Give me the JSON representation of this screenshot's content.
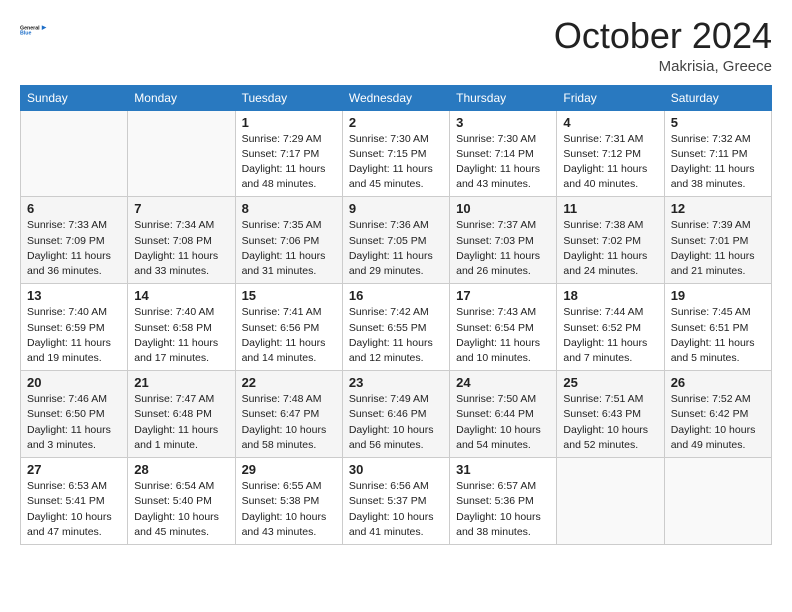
{
  "header": {
    "logo_line1": "General",
    "logo_line2": "Blue",
    "month": "October 2024",
    "location": "Makrisia, Greece"
  },
  "days_of_week": [
    "Sunday",
    "Monday",
    "Tuesday",
    "Wednesday",
    "Thursday",
    "Friday",
    "Saturday"
  ],
  "weeks": [
    [
      {
        "day": "",
        "info": ""
      },
      {
        "day": "",
        "info": ""
      },
      {
        "day": "1",
        "info": "Sunrise: 7:29 AM\nSunset: 7:17 PM\nDaylight: 11 hours and 48 minutes."
      },
      {
        "day": "2",
        "info": "Sunrise: 7:30 AM\nSunset: 7:15 PM\nDaylight: 11 hours and 45 minutes."
      },
      {
        "day": "3",
        "info": "Sunrise: 7:30 AM\nSunset: 7:14 PM\nDaylight: 11 hours and 43 minutes."
      },
      {
        "day": "4",
        "info": "Sunrise: 7:31 AM\nSunset: 7:12 PM\nDaylight: 11 hours and 40 minutes."
      },
      {
        "day": "5",
        "info": "Sunrise: 7:32 AM\nSunset: 7:11 PM\nDaylight: 11 hours and 38 minutes."
      }
    ],
    [
      {
        "day": "6",
        "info": "Sunrise: 7:33 AM\nSunset: 7:09 PM\nDaylight: 11 hours and 36 minutes."
      },
      {
        "day": "7",
        "info": "Sunrise: 7:34 AM\nSunset: 7:08 PM\nDaylight: 11 hours and 33 minutes."
      },
      {
        "day": "8",
        "info": "Sunrise: 7:35 AM\nSunset: 7:06 PM\nDaylight: 11 hours and 31 minutes."
      },
      {
        "day": "9",
        "info": "Sunrise: 7:36 AM\nSunset: 7:05 PM\nDaylight: 11 hours and 29 minutes."
      },
      {
        "day": "10",
        "info": "Sunrise: 7:37 AM\nSunset: 7:03 PM\nDaylight: 11 hours and 26 minutes."
      },
      {
        "day": "11",
        "info": "Sunrise: 7:38 AM\nSunset: 7:02 PM\nDaylight: 11 hours and 24 minutes."
      },
      {
        "day": "12",
        "info": "Sunrise: 7:39 AM\nSunset: 7:01 PM\nDaylight: 11 hours and 21 minutes."
      }
    ],
    [
      {
        "day": "13",
        "info": "Sunrise: 7:40 AM\nSunset: 6:59 PM\nDaylight: 11 hours and 19 minutes."
      },
      {
        "day": "14",
        "info": "Sunrise: 7:40 AM\nSunset: 6:58 PM\nDaylight: 11 hours and 17 minutes."
      },
      {
        "day": "15",
        "info": "Sunrise: 7:41 AM\nSunset: 6:56 PM\nDaylight: 11 hours and 14 minutes."
      },
      {
        "day": "16",
        "info": "Sunrise: 7:42 AM\nSunset: 6:55 PM\nDaylight: 11 hours and 12 minutes."
      },
      {
        "day": "17",
        "info": "Sunrise: 7:43 AM\nSunset: 6:54 PM\nDaylight: 11 hours and 10 minutes."
      },
      {
        "day": "18",
        "info": "Sunrise: 7:44 AM\nSunset: 6:52 PM\nDaylight: 11 hours and 7 minutes."
      },
      {
        "day": "19",
        "info": "Sunrise: 7:45 AM\nSunset: 6:51 PM\nDaylight: 11 hours and 5 minutes."
      }
    ],
    [
      {
        "day": "20",
        "info": "Sunrise: 7:46 AM\nSunset: 6:50 PM\nDaylight: 11 hours and 3 minutes."
      },
      {
        "day": "21",
        "info": "Sunrise: 7:47 AM\nSunset: 6:48 PM\nDaylight: 11 hours and 1 minute."
      },
      {
        "day": "22",
        "info": "Sunrise: 7:48 AM\nSunset: 6:47 PM\nDaylight: 10 hours and 58 minutes."
      },
      {
        "day": "23",
        "info": "Sunrise: 7:49 AM\nSunset: 6:46 PM\nDaylight: 10 hours and 56 minutes."
      },
      {
        "day": "24",
        "info": "Sunrise: 7:50 AM\nSunset: 6:44 PM\nDaylight: 10 hours and 54 minutes."
      },
      {
        "day": "25",
        "info": "Sunrise: 7:51 AM\nSunset: 6:43 PM\nDaylight: 10 hours and 52 minutes."
      },
      {
        "day": "26",
        "info": "Sunrise: 7:52 AM\nSunset: 6:42 PM\nDaylight: 10 hours and 49 minutes."
      }
    ],
    [
      {
        "day": "27",
        "info": "Sunrise: 6:53 AM\nSunset: 5:41 PM\nDaylight: 10 hours and 47 minutes."
      },
      {
        "day": "28",
        "info": "Sunrise: 6:54 AM\nSunset: 5:40 PM\nDaylight: 10 hours and 45 minutes."
      },
      {
        "day": "29",
        "info": "Sunrise: 6:55 AM\nSunset: 5:38 PM\nDaylight: 10 hours and 43 minutes."
      },
      {
        "day": "30",
        "info": "Sunrise: 6:56 AM\nSunset: 5:37 PM\nDaylight: 10 hours and 41 minutes."
      },
      {
        "day": "31",
        "info": "Sunrise: 6:57 AM\nSunset: 5:36 PM\nDaylight: 10 hours and 38 minutes."
      },
      {
        "day": "",
        "info": ""
      },
      {
        "day": "",
        "info": ""
      }
    ]
  ]
}
